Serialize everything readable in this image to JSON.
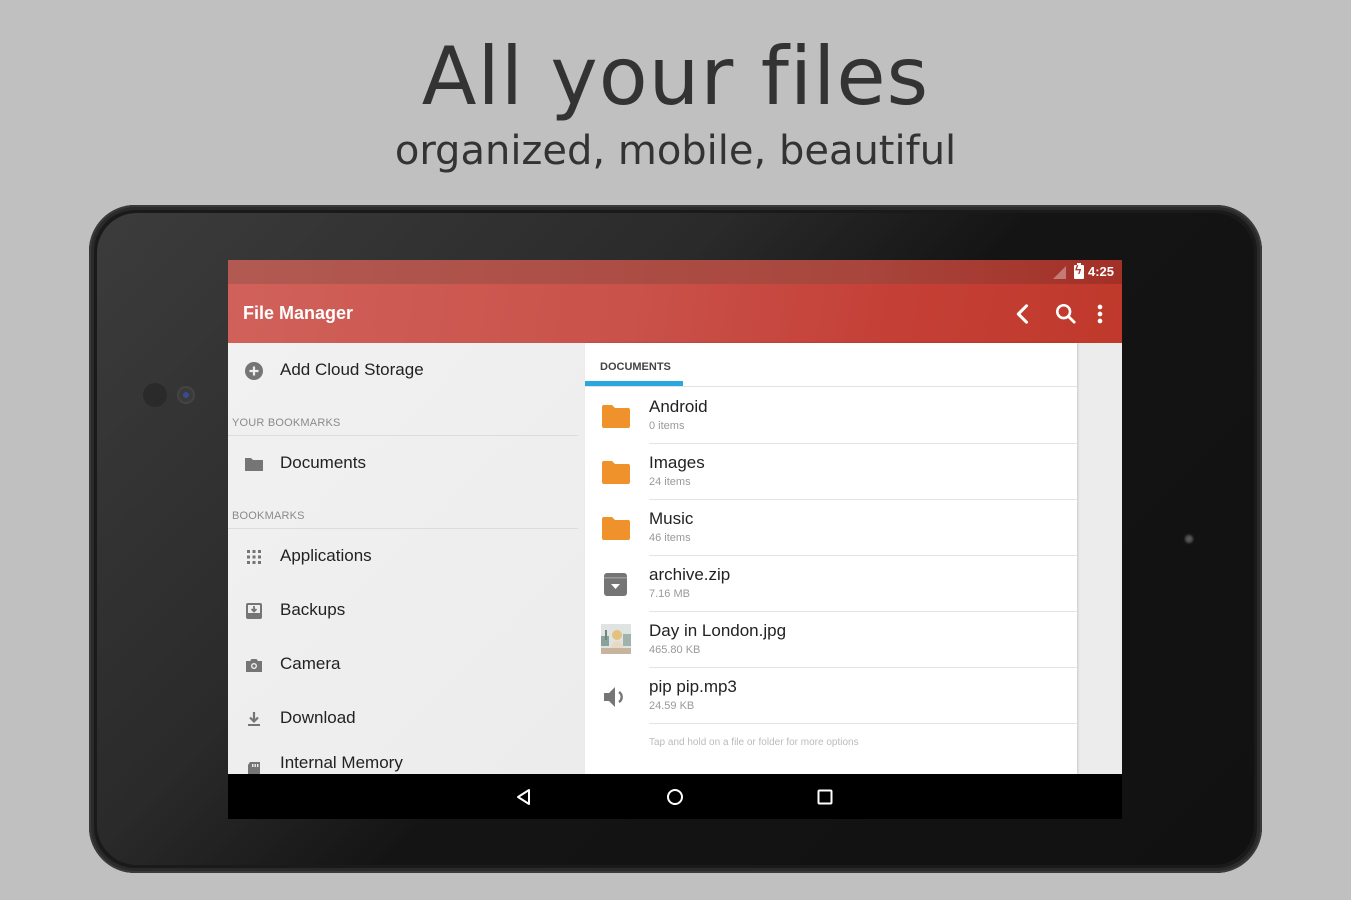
{
  "promo": {
    "headline": "All your files",
    "subheadline": "organized, mobile, beautiful"
  },
  "status_bar": {
    "time": "4:25",
    "icons": [
      "signal-icon",
      "battery-charging-icon"
    ]
  },
  "app_bar": {
    "title": "File Manager",
    "actions": [
      "back-icon",
      "search-icon",
      "more-vert-icon"
    ]
  },
  "sidebar": {
    "add_cloud": "Add Cloud Storage",
    "your_bookmarks_header": "YOUR BOOKMARKS",
    "your_bookmarks": [
      {
        "label": "Documents",
        "icon": "folder-icon"
      }
    ],
    "bookmarks_header": "BOOKMARKS",
    "bookmarks": [
      {
        "label": "Applications",
        "icon": "apps-grid-icon"
      },
      {
        "label": "Backups",
        "icon": "backup-inbox-icon"
      },
      {
        "label": "Camera",
        "icon": "camera-icon"
      },
      {
        "label": "Download",
        "icon": "download-icon"
      },
      {
        "label": "Internal Memory",
        "icon": "sd-card-icon"
      }
    ]
  },
  "panel": {
    "tab": "DOCUMENTS",
    "accent_color": "#29a8e0",
    "files": [
      {
        "name": "Android",
        "meta": "0 items",
        "type": "folder"
      },
      {
        "name": "Images",
        "meta": "24 items",
        "type": "folder"
      },
      {
        "name": "Music",
        "meta": "46 items",
        "type": "folder"
      },
      {
        "name": "archive.zip",
        "meta": "7.16 MB",
        "type": "archive"
      },
      {
        "name": "Day in London.jpg",
        "meta": "465.80 KB",
        "type": "image"
      },
      {
        "name": "pip pip.mp3",
        "meta": "24.59 KB",
        "type": "audio"
      }
    ],
    "hint": "Tap and hold on a file or folder for more options"
  },
  "colors": {
    "primary": "#c9524a",
    "folder": "#f0922b",
    "icon_gray": "#757575"
  }
}
